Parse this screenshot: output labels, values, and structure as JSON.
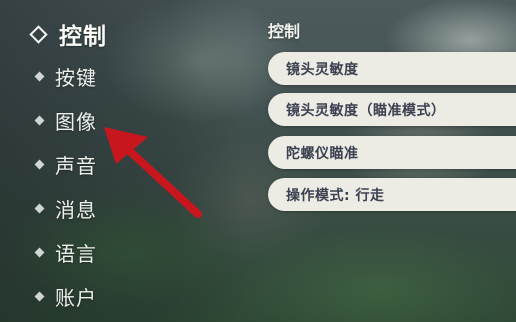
{
  "nav": {
    "items": [
      {
        "label": "控制",
        "active": true
      },
      {
        "label": "按键"
      },
      {
        "label": "图像"
      },
      {
        "label": "声音"
      },
      {
        "label": "消息"
      },
      {
        "label": "语言"
      },
      {
        "label": "账户"
      }
    ]
  },
  "section": {
    "title": "控制",
    "settings": [
      {
        "label": "镜头灵敏度"
      },
      {
        "label": "镜头灵敏度（瞄准模式）"
      },
      {
        "label": "陀螺仪瞄准"
      },
      {
        "label": "操作模式: 行走"
      }
    ]
  },
  "annotation": {
    "arrow_color": "#c8161e"
  }
}
